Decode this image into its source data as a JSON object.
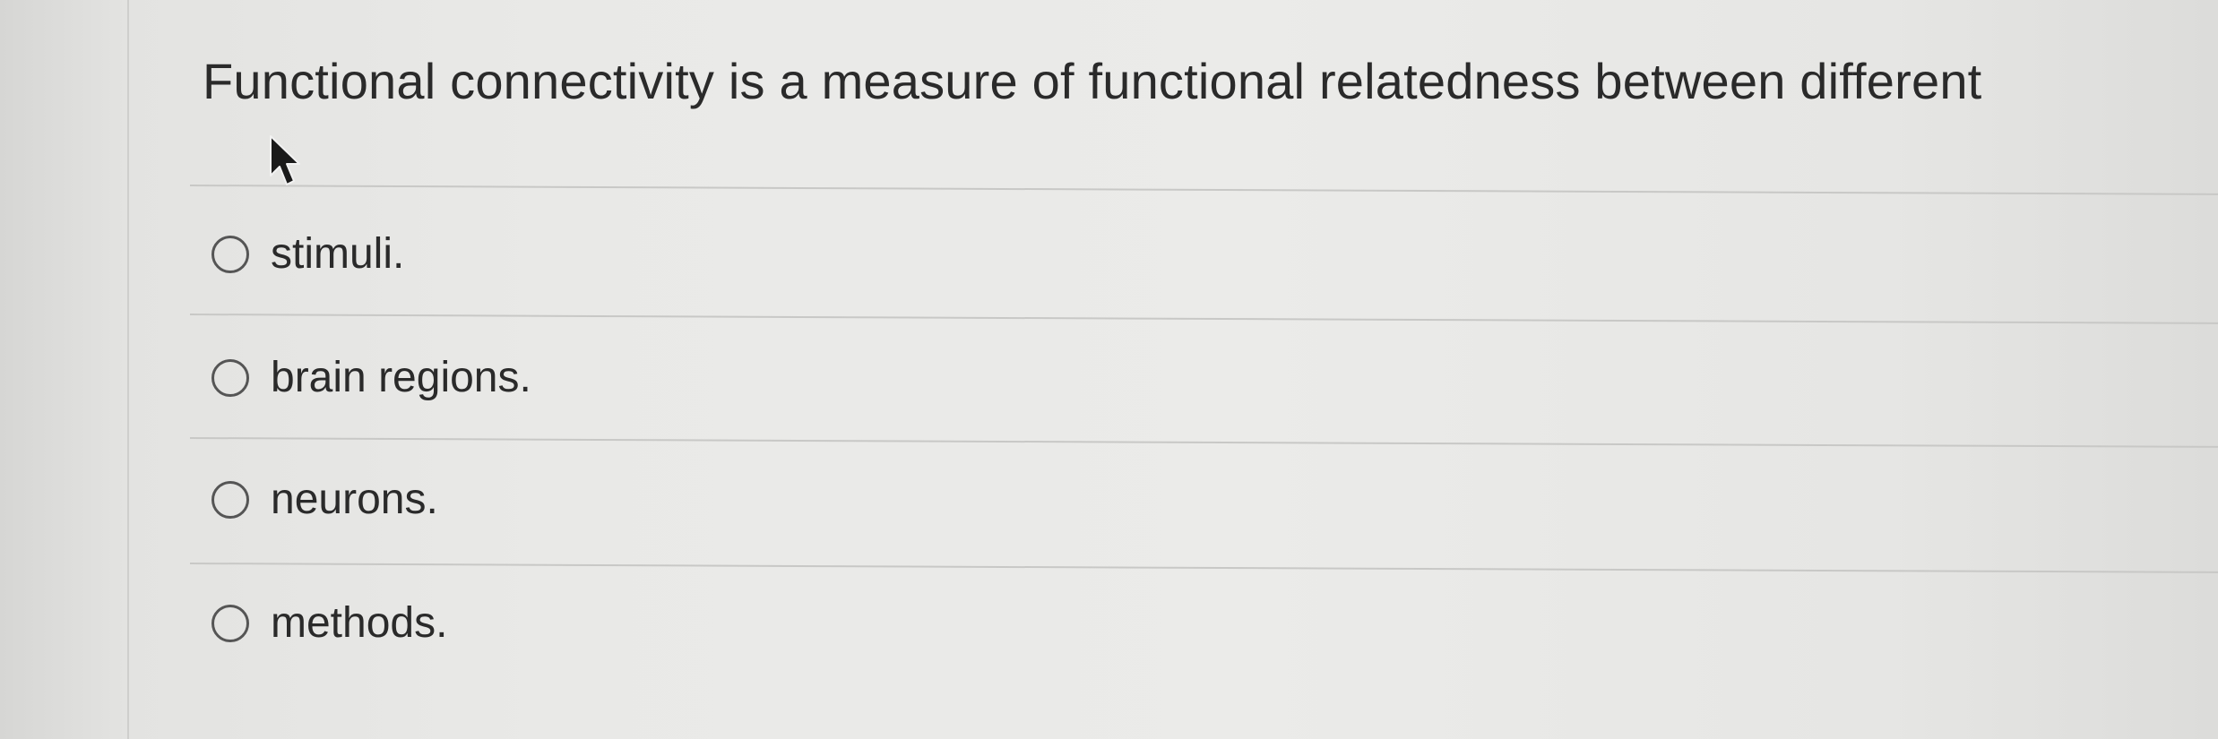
{
  "question": {
    "text": "Functional connectivity is a measure of functional relatedness between different"
  },
  "options": [
    {
      "label": "stimuli.",
      "selected": false
    },
    {
      "label": "brain regions.",
      "selected": false
    },
    {
      "label": "neurons.",
      "selected": false
    },
    {
      "label": "methods.",
      "selected": false
    }
  ],
  "cursor": {
    "icon": "mouse-pointer-icon"
  },
  "colors": {
    "text": "#2a2a2a",
    "radio_border": "#555555",
    "divider": "#c8c8c6",
    "background": "#e9e9e7"
  }
}
